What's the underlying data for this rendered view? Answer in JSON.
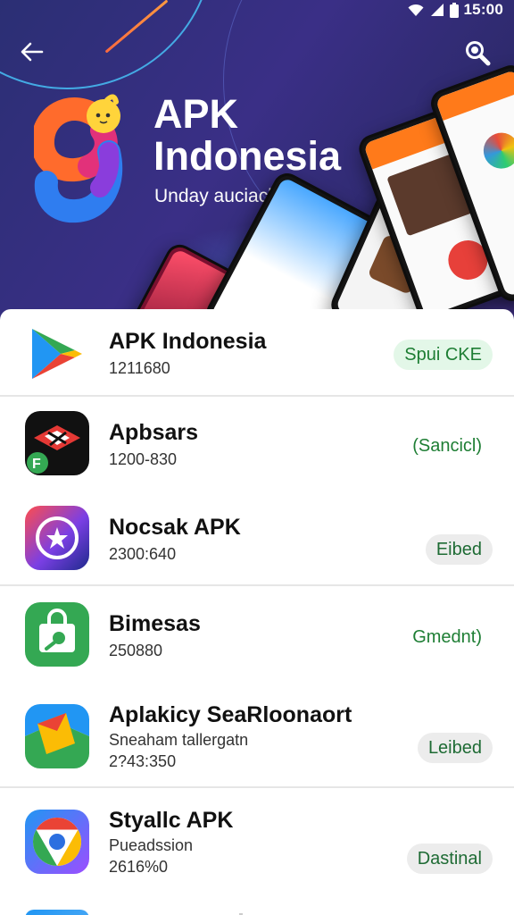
{
  "status_bar": {
    "time": "15:00"
  },
  "hero": {
    "title_line1": "APK",
    "title_line2": "Indonesia",
    "subtitle": "Unday auciacbien"
  },
  "apps": [
    {
      "name": "APK Indonesia",
      "subtitle": "",
      "meta": "1211680",
      "action": "Spui CKE",
      "icon": "play-store-icon"
    },
    {
      "name": "Apbsars",
      "subtitle": "",
      "meta": "1200-830",
      "action": "(Sancicl)",
      "icon": "apbsars-app-icon"
    },
    {
      "name": "Nocsak APK",
      "subtitle": "",
      "meta": "2300:640",
      "action": "Eibed",
      "icon": "star-compass-icon"
    },
    {
      "name": "Bimesas",
      "subtitle": "",
      "meta": "250880",
      "action": "Gmednt)",
      "icon": "shopping-bag-icon"
    },
    {
      "name": "Aplakicy SeaRloonaort",
      "subtitle": "Sneaham tallergatn",
      "meta": "2?43:350",
      "action": "Leibed",
      "icon": "colorful-folder-icon"
    },
    {
      "name": "Styallc APK",
      "subtitle": "Pueadssion",
      "meta": "2616%0",
      "action": "Dastinal",
      "icon": "chrome-like-icon"
    }
  ],
  "colors": {
    "hero_bg": "#2b2f74",
    "accent_green": "#1e7e34",
    "pill_green_bg": "#e3f7e8"
  }
}
